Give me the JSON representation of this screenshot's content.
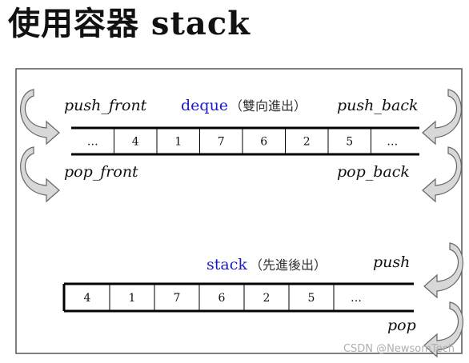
{
  "page_title": "使用容器 stack",
  "deque": {
    "title": "deque",
    "title_note": "（雙向進出）",
    "push_front": "push_front",
    "push_back": "push_back",
    "pop_front": "pop_front",
    "pop_back": "pop_back",
    "cells": [
      "…",
      "4",
      "1",
      "7",
      "6",
      "2",
      "5",
      "…"
    ]
  },
  "stack": {
    "title": "stack",
    "title_note": "（先進後出）",
    "push": "push",
    "pop": "pop",
    "cells": [
      "4",
      "1",
      "7",
      "6",
      "2",
      "5",
      "…"
    ]
  },
  "watermark": "CSDN @NewsomTech",
  "colors": {
    "title_blue": "#1a1acc",
    "arrow_fill": "#d8d8d8",
    "arrow_stroke": "#666666",
    "panel_border": "#555555"
  }
}
